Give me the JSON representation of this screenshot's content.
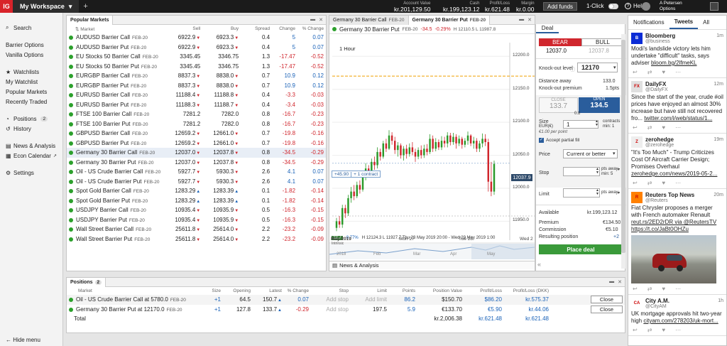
{
  "topbar": {
    "logo": "IG",
    "workspace": "My Workspace",
    "workspace_caret": "▾",
    "plus": "+",
    "account": [
      {
        "label": "Account Value",
        "value": "kr.201,129.50"
      },
      {
        "label": "Cash",
        "value": "kr.199,123.12"
      },
      {
        "label": "Profit/Loss",
        "value": "kr.621.48"
      },
      {
        "label": "Margin",
        "value": "kr.0.00"
      }
    ],
    "add_funds": "Add funds",
    "one_click": "1-Click",
    "help": "Help",
    "help_icon": "?",
    "user_line1": "A Petersen",
    "user_line2": "Options"
  },
  "leftnav": {
    "search": "Search",
    "items_a": [
      "Barrier Options",
      "Vanilla Options"
    ],
    "watchlists": "Watchlists",
    "items_b": [
      "My Watchlist",
      "Popular Markets",
      "Recently Traded"
    ],
    "positions": "Positions",
    "positions_count": "2",
    "history": "History",
    "news": "News & Analysis",
    "econ": "Econ Calendar",
    "settings": "Settings",
    "hide_menu": "Hide menu"
  },
  "markets": {
    "tab": "Popular Markets",
    "headers": {
      "market": "Market",
      "sell": "Sell",
      "buy": "Buy",
      "spread": "Spread",
      "change": "Change",
      "pct": "% Change"
    },
    "rows": [
      {
        "name": "AUDUSD Barrier Call",
        "exp": "FEB-20",
        "sell": "6922.9",
        "sd": "dn",
        "buy": "6923.3",
        "bd": "dn",
        "spread": "0.4",
        "change": "5",
        "pct": "0.07"
      },
      {
        "name": "AUDUSD Barrier Put",
        "exp": "FEB-20",
        "sell": "6922.9",
        "sd": "dn",
        "buy": "6923.3",
        "bd": "dn",
        "spread": "0.4",
        "change": "5",
        "pct": "0.07"
      },
      {
        "name": "EU Stocks 50 Barrier Call",
        "exp": "FEB-20",
        "sell": "3345.45",
        "sd": "",
        "buy": "3346.75",
        "bd": "",
        "spread": "1.3",
        "change": "-17.47",
        "pct": "-0.52"
      },
      {
        "name": "EU Stocks 50 Barrier Put",
        "exp": "FEB-20",
        "sell": "3345.45",
        "sd": "",
        "buy": "3346.75",
        "bd": "",
        "spread": "1.3",
        "change": "-17.47",
        "pct": "-0.52"
      },
      {
        "name": "EURGBP Barrier Call",
        "exp": "FEB-20",
        "sell": "8837.3",
        "sd": "dn",
        "buy": "8838.0",
        "bd": "dn",
        "spread": "0.7",
        "change": "10.9",
        "pct": "0.12"
      },
      {
        "name": "EURGBP Barrier Put",
        "exp": "FEB-20",
        "sell": "8837.3",
        "sd": "dn",
        "buy": "8838.0",
        "bd": "dn",
        "spread": "0.7",
        "change": "10.9",
        "pct": "0.12"
      },
      {
        "name": "EURUSD Barrier Call",
        "exp": "FEB-20",
        "sell": "11188.4",
        "sd": "dn",
        "buy": "11188.8",
        "bd": "dn",
        "spread": "0.4",
        "change": "-3.3",
        "pct": "-0.03"
      },
      {
        "name": "EURUSD Barrier Put",
        "exp": "FEB-20",
        "sell": "11188.3",
        "sd": "dn",
        "buy": "11188.7",
        "bd": "dn",
        "spread": "0.4",
        "change": "-3.4",
        "pct": "-0.03"
      },
      {
        "name": "FTSE 100 Barrier Call",
        "exp": "FEB-20",
        "sell": "7281.2",
        "sd": "",
        "buy": "7282.0",
        "bd": "",
        "spread": "0.8",
        "change": "-16.7",
        "pct": "-0.23"
      },
      {
        "name": "FTSE 100 Barrier Put",
        "exp": "FEB-20",
        "sell": "7281.2",
        "sd": "",
        "buy": "7282.0",
        "bd": "",
        "spread": "0.8",
        "change": "-16.7",
        "pct": "-0.23"
      },
      {
        "name": "GBPUSD Barrier Call",
        "exp": "FEB-20",
        "sell": "12659.2",
        "sd": "dn",
        "buy": "12661.0",
        "bd": "dn",
        "spread": "0.7",
        "change": "-19.8",
        "pct": "-0.16"
      },
      {
        "name": "GBPUSD Barrier Put",
        "exp": "FEB-20",
        "sell": "12659.2",
        "sd": "dn",
        "buy": "12661.0",
        "bd": "dn",
        "spread": "0.7",
        "change": "-19.8",
        "pct": "-0.16"
      },
      {
        "name": "Germany 30 Barrier Call",
        "exp": "FEB-20",
        "sell": "12037.0",
        "sd": "dn",
        "buy": "12037.8",
        "bd": "dn",
        "spread": "0.8",
        "change": "-34.5",
        "pct": "-0.29"
      },
      {
        "name": "Germany 30 Barrier Put",
        "exp": "FEB-20",
        "sell": "12037.0",
        "sd": "dn",
        "buy": "12037.8",
        "bd": "dn",
        "spread": "0.8",
        "change": "-34.5",
        "pct": "-0.29"
      },
      {
        "name": "Oil - US Crude Barrier Call",
        "exp": "FEB-20",
        "sell": "5927.7",
        "sd": "dn",
        "buy": "5930.3",
        "bd": "dn",
        "spread": "2.6",
        "change": "4.1",
        "pct": "0.07"
      },
      {
        "name": "Oil - US Crude Barrier Put",
        "exp": "FEB-20",
        "sell": "5927.7",
        "sd": "dn",
        "buy": "5930.3",
        "bd": "dn",
        "spread": "2.6",
        "change": "4.1",
        "pct": "0.07"
      },
      {
        "name": "Spot Gold Barrier Call",
        "exp": "FEB-20",
        "sell": "1283.29",
        "sd": "up",
        "buy": "1283.39",
        "bd": "up",
        "spread": "0.1",
        "change": "-1.82",
        "pct": "-0.14"
      },
      {
        "name": "Spot Gold Barrier Put",
        "exp": "FEB-20",
        "sell": "1283.29",
        "sd": "up",
        "buy": "1283.39",
        "bd": "up",
        "spread": "0.1",
        "change": "-1.82",
        "pct": "-0.14"
      },
      {
        "name": "USDJPY Barrier Call",
        "exp": "FEB-20",
        "sell": "10935.4",
        "sd": "dn",
        "buy": "10935.9",
        "bd": "dn",
        "spread": "0.5",
        "change": "-16.3",
        "pct": "-0.15"
      },
      {
        "name": "USDJPY Barrier Put",
        "exp": "FEB-20",
        "sell": "10935.4",
        "sd": "dn",
        "buy": "10935.9",
        "bd": "dn",
        "spread": "0.5",
        "change": "-16.3",
        "pct": "-0.15"
      },
      {
        "name": "Wall Street Barrier Call",
        "exp": "FEB-20",
        "sell": "25611.8",
        "sd": "dn",
        "buy": "25614.0",
        "bd": "dn",
        "spread": "2.2",
        "change": "-23.2",
        "pct": "-0.09"
      },
      {
        "name": "Wall Street Barrier Put",
        "exp": "FEB-20",
        "sell": "25611.8",
        "sd": "dn",
        "buy": "25614.0",
        "bd": "dn",
        "spread": "2.2",
        "change": "-23.2",
        "pct": "-0.09"
      }
    ]
  },
  "chart": {
    "tabs": [
      {
        "label": "Germany 30 Barrier Call",
        "exp": "FEB-20"
      },
      {
        "label": "Germany 30 Barrier Put",
        "exp": "FEB-20"
      }
    ],
    "header": {
      "name": "Germany 30 Barrier Put",
      "exp": "FEB-20",
      "change": "-34.5",
      "pct": "-0.29%",
      "ohlc": "H 12110.5 L 11987.8"
    },
    "interval": "1 Hour",
    "y_ticks": [
      "12200.0",
      "12150.0",
      "12100.0",
      "12050.0",
      "12000.0",
      "11950.0"
    ],
    "current_price": "12037.9",
    "position_tag": "+45.90",
    "position_contracts": "+ 1 contract",
    "info_line": "H 12124.3  L 11927.7   Thu 23 May 2019 20:00 - Wed 29 May 2019 1:00",
    "small_left": "22.7",
    "small_pct": "0.77%",
    "small_lbl": "Intrinsic",
    "x_labels": [
      "May 2019",
      "Mon 27",
      "Tue 28",
      "Wed 2"
    ],
    "nav_labels": [
      "2018",
      "Feb",
      "Mar",
      "Apr",
      "May"
    ],
    "news_tab": "News & Analysis",
    "collapse_arrow": "«"
  },
  "chart_data": {
    "type": "candlestick",
    "ylim": [
      11930,
      12210
    ],
    "y_ticks": [
      12200,
      12150,
      12100,
      12050,
      12000,
      11950
    ],
    "barrier_level": 12170,
    "current_price": 12037.9,
    "candles": [
      [
        11940,
        11950,
        11935,
        11955
      ],
      [
        11950,
        11945,
        11940,
        11958
      ],
      [
        11945,
        11970,
        11940,
        11975
      ],
      [
        11970,
        11962,
        11955,
        11975
      ],
      [
        11962,
        11985,
        11958,
        11990
      ],
      [
        11985,
        11995,
        11978,
        12002
      ],
      [
        11995,
        11988,
        11982,
        12005
      ],
      [
        11988,
        12005,
        11985,
        12010
      ],
      [
        12005,
        11998,
        11992,
        12012
      ],
      [
        11998,
        12020,
        11995,
        12025
      ],
      [
        12020,
        12030,
        12012,
        12038
      ],
      [
        12030,
        12022,
        12018,
        12035
      ],
      [
        12022,
        12040,
        12018,
        12045
      ],
      [
        12040,
        12035,
        12028,
        12048
      ],
      [
        12035,
        12055,
        12030,
        12062
      ],
      [
        12055,
        12048,
        12042,
        12060
      ],
      [
        12048,
        12068,
        12045,
        12072
      ],
      [
        12068,
        12060,
        12055,
        12075
      ],
      [
        12060,
        12080,
        12058,
        12088
      ],
      [
        12080,
        12072,
        12066,
        12085
      ],
      [
        12072,
        12058,
        12052,
        12078
      ],
      [
        12058,
        12065,
        12048,
        12070
      ],
      [
        12065,
        12050,
        12045,
        12068
      ],
      [
        12050,
        12060,
        12042,
        12064
      ],
      [
        12060,
        12052,
        12045,
        12066
      ],
      [
        12052,
        12062,
        12048,
        12068
      ],
      [
        12062,
        12055,
        12050,
        12070
      ],
      [
        12055,
        12048,
        12040,
        12060
      ],
      [
        12048,
        12058,
        12044,
        12062
      ],
      [
        12058,
        12050,
        12045,
        12065
      ],
      [
        12050,
        12060,
        12046,
        12066
      ],
      [
        12060,
        12055,
        12050,
        12067
      ],
      [
        12055,
        12075,
        12052,
        12082
      ],
      [
        12075,
        12060,
        12055,
        12080
      ],
      [
        12060,
        12070,
        12056,
        12076
      ],
      [
        12070,
        12062,
        12058,
        12074
      ],
      [
        12062,
        12072,
        12058,
        12079
      ],
      [
        12072,
        12068,
        12062,
        12078
      ],
      [
        12068,
        12080,
        12062,
        12085
      ],
      [
        12080,
        12070,
        12065,
        12084
      ],
      [
        12070,
        12078,
        12066,
        12084
      ],
      [
        12078,
        12068,
        12060,
        12082
      ],
      [
        12068,
        12075,
        12064,
        12080
      ],
      [
        12075,
        12066,
        12060,
        12078
      ],
      [
        12066,
        12072,
        12062,
        12076
      ],
      [
        12072,
        12080,
        12066,
        12086
      ],
      [
        12080,
        12068,
        12064,
        12082
      ],
      [
        12068,
        12072,
        12060,
        12078
      ],
      [
        12072,
        12060,
        12055,
        12076
      ],
      [
        12060,
        12068,
        12055,
        12072
      ],
      [
        12068,
        12075,
        12062,
        12083
      ],
      [
        12075,
        12070,
        12064,
        12082
      ],
      [
        12070,
        12010,
        11995,
        12075
      ],
      [
        12010,
        11995,
        11988,
        12040
      ],
      [
        11995,
        12037,
        11990,
        12042
      ]
    ]
  },
  "deal": {
    "tab": "Deal",
    "bear": "BEAR",
    "bull": "BULL",
    "bear_price": "12037.0",
    "bull_price": "12037.8",
    "ko_label": "Knock-out level",
    "ko_value": "12170",
    "distance_label": "Distance away",
    "distance_value": "133.0",
    "premium_label": "Knock-out premium",
    "premium_value": "1.5pts",
    "close_label": "CLOSE",
    "close_price": "133.7",
    "open_label": "OPEN",
    "open_price": "134.5",
    "spread": "0.8",
    "size_label": "Size",
    "size_unit": "EUR(€)",
    "size_value": "1",
    "contracts": "contracts",
    "min": "min: 1",
    "per_point": "€1.00 per point",
    "partial_fill": "Accept partial fill",
    "price_label": "Price",
    "price_value": "Current or better",
    "stop_label": "Stop",
    "stop_away": "pts away",
    "stop_min": "min: 5",
    "limit_label": "Limit",
    "limit_away": "pts away",
    "available_label": "Available",
    "available_value": "kr.199,123.12",
    "premium2_label": "Premium",
    "premium2_value": "€134.50",
    "commission_label": "Commission",
    "commission_value": "€5.10",
    "resulting_label": "Resulting position",
    "resulting_value": "+2",
    "place_deal": "Place deal"
  },
  "positions": {
    "tab": "Positions",
    "count": "2",
    "headers": [
      "Market",
      "Size",
      "Opening",
      "Latest",
      "% Change",
      "Stop",
      "Limit",
      "Points",
      "Position Value",
      "Profit/Loss",
      "Profit/Loss (DKK)"
    ],
    "rows": [
      {
        "name": "Oil - US Crude Barrier Call at 5780.0",
        "exp": "FEB-20",
        "size": "+1",
        "opening": "64.5",
        "latest": "150.7",
        "pct": "0.07",
        "stop": "Add stop",
        "limit": "Add limit",
        "points": "86.2",
        "value": "$150.70",
        "pl": "$86.20",
        "pldkk": "kr.575.37",
        "close": "Close"
      },
      {
        "name": "Germany 30 Barrier Put at 12170.0",
        "exp": "FEB-20",
        "size": "+1",
        "opening": "127.8",
        "latest": "133.7",
        "pct": "-0.29",
        "stop": "Add stop",
        "limit": "197.5",
        "points": "5.9",
        "value": "€133.70",
        "pl": "€5.90",
        "pldkk": "kr.44.06",
        "close": "Close"
      }
    ],
    "total_label": "Total",
    "total_value": "kr.2,006.38",
    "total_pl": "kr.621.48",
    "total_pldkk": "kr.621.48"
  },
  "twitter": {
    "tabs": [
      "Notifications",
      "Tweets",
      "All"
    ],
    "tweets": [
      {
        "name": "Bloomberg",
        "handle": "@business",
        "time": "1m",
        "text": "Modi's landslide victory lets him undertake \"difficult\" tasks, says adviser ",
        "link": "bloom.bg/2lfmeKL"
      },
      {
        "name": "DailyFX",
        "handle": "@DailyFX",
        "time": "12m",
        "text": "Since the start of the year, crude #oil prices have enjoyed an almost 30% increase but have still not recovered fro... ",
        "link": "twitter.com/i/web/status/1..."
      },
      {
        "name": "zerohedge",
        "handle": "@zerohedge",
        "time": "19m",
        "text": "\"It's Too Much\" - Trump Criticizes Cost Of Aircraft Carrier Design; Promises Overhaul ",
        "link": "zerohedge.com/news/2019-05-2..."
      },
      {
        "name": "Reuters Top News",
        "handle": "@Reuters",
        "time": "20m",
        "text": "Fiat Chrysler proposes a merger with French automaker Renault ",
        "link": "reut.rs/2ED2rDR via @ReutersTV https://t.co/JaBt0OHZu"
      },
      {
        "name": "City A.M.",
        "handle": "@CityAM",
        "time": "1h",
        "text": "UK mortgage approvals hit two-year high ",
        "link": "cityam.com/278203/uk-mort..."
      }
    ]
  }
}
